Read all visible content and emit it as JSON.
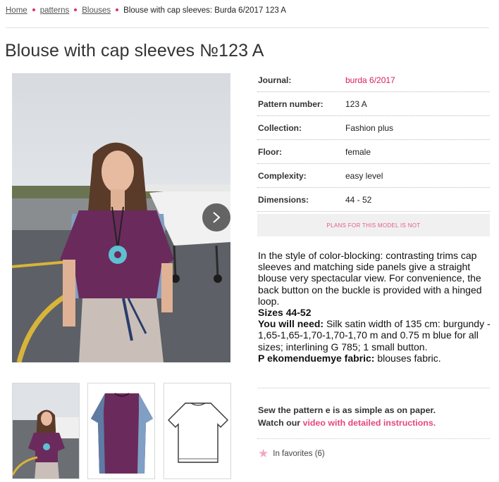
{
  "breadcrumb": {
    "items": [
      "Home",
      "patterns",
      "Blouses"
    ],
    "current": "Blouse with cap sleeves: Burda 6/2017 123 A"
  },
  "title": "Blouse with cap sleeves №123 A",
  "details": [
    {
      "label": "Journal:",
      "value": "burda 6/2017"
    },
    {
      "label": "Pattern number:",
      "value": "123 A"
    },
    {
      "label": "Collection:",
      "value": "Fashion plus"
    },
    {
      "label": "Floor:",
      "value": "female"
    },
    {
      "label": "Complexity:",
      "value": "easy level"
    },
    {
      "label": "Dimensions:",
      "value": "44 - 52"
    }
  ],
  "plans_notice": "PLANS FOR THIS MODEL IS NOT",
  "description": {
    "text": "In the style of color-blocking: contrasting trims cap sleeves and matching side panels give a straight blouse very spectacular view. For convenience, the back button on the buckle is provided with a hinged loop.",
    "sizes": "Sizes 44-52",
    "need_label": "You will need:",
    "need_text": " Silk satin width of 135 cm: burgundy - 1,65-1,65-1,70-1,70-1,70 m and 0.75 m blue for all sizes; interlining G 785; 1 small button.",
    "fabric_label": "P ekomenduemye fabric:",
    "fabric_text": " blouses fabric."
  },
  "sew": {
    "line1": "Sew the pattern e is as simple as on paper.",
    "line2_prefix": "Watch our ",
    "link": "video with detailed instructions."
  },
  "favorites": "In favorites (6)",
  "colors": {
    "accent": "#e0325f",
    "link": "#d81e57",
    "blouse": "#6b2a5c",
    "blue_panel": "#7f9fc4",
    "pendant": "#5fc0d2"
  },
  "icons": [
    "chevron-right-icon",
    "star-icon"
  ]
}
